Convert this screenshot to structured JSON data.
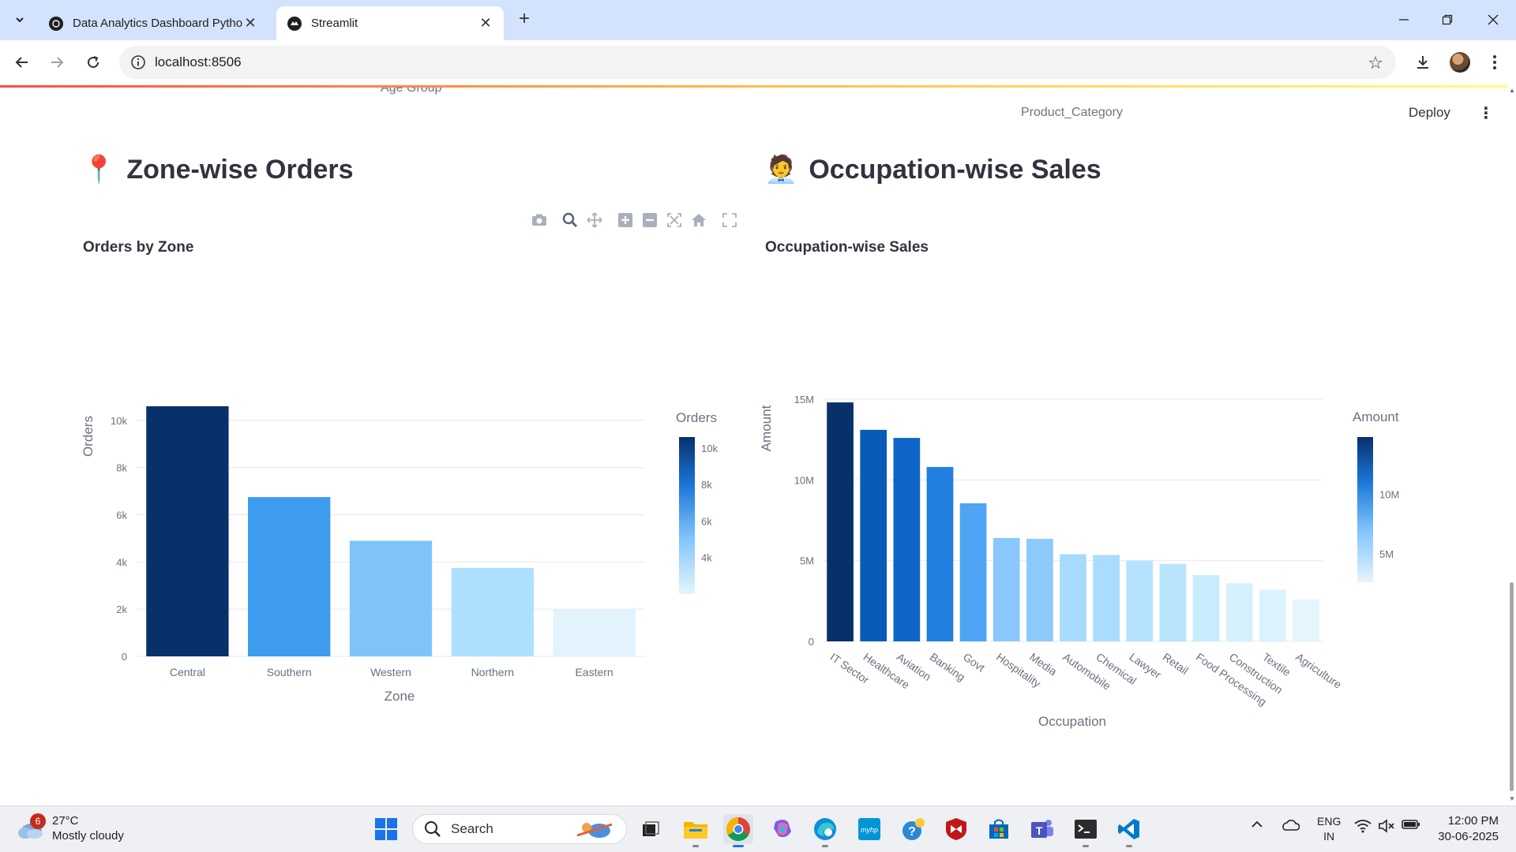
{
  "browser": {
    "tabs": [
      {
        "title": "Data Analytics Dashboard Pytho",
        "active": false
      },
      {
        "title": "Streamlit",
        "active": true
      }
    ],
    "url": "localhost:8506"
  },
  "app": {
    "cut_labels": {
      "age_group": "Age Group",
      "product_category": "Product_Category"
    },
    "deploy_label": "Deploy",
    "sections": {
      "zone": {
        "emoji": "📍",
        "title": "Zone-wise Orders"
      },
      "occupation": {
        "emoji": "🧑‍💼",
        "title": "Occupation-wise Sales"
      }
    }
  },
  "charts": {
    "zone": {
      "title": "Orders by Zone",
      "xlabel": "Zone",
      "ylabel": "Orders",
      "colorbar_title": "Orders",
      "y_ticks": [
        "0",
        "2k",
        "4k",
        "6k",
        "8k",
        "10k"
      ],
      "colorbar_ticks": [
        "10k",
        "8k",
        "6k",
        "4k"
      ]
    },
    "occupation": {
      "title": "Occupation-wise Sales",
      "xlabel": "Occupation",
      "ylabel": "Amount",
      "colorbar_title": "Amount",
      "y_ticks": [
        "0",
        "5M",
        "10M",
        "15M"
      ],
      "colorbar_ticks": [
        "10M",
        "5M"
      ]
    }
  },
  "chart_data": [
    {
      "type": "bar",
      "title": "Orders by Zone",
      "xlabel": "Zone",
      "ylabel": "Orders",
      "categories": [
        "Central",
        "Southern",
        "Western",
        "Northern",
        "Eastern"
      ],
      "values": [
        10600,
        6750,
        4900,
        3750,
        2000
      ],
      "ylim": [
        0,
        10800
      ],
      "colorscale": "Blues",
      "colors": [
        "#08306b",
        "#3d9bf0",
        "#7ec4fb",
        "#ade0fe",
        "#e3f3fe"
      ],
      "grid": true,
      "legend": "colorbar right"
    },
    {
      "type": "bar",
      "title": "Occupation-wise Sales",
      "xlabel": "Occupation",
      "ylabel": "Amount",
      "categories": [
        "IT Sector",
        "Healthcare",
        "Aviation",
        "Banking",
        "Govt",
        "Hospitality",
        "Media",
        "Automobile",
        "Chemical",
        "Lawyer",
        "Retail",
        "Food Processing",
        "Construction",
        "Textile",
        "Agriculture"
      ],
      "values": [
        14800000,
        13100000,
        12600000,
        10800000,
        8550000,
        6400000,
        6350000,
        5400000,
        5350000,
        5000000,
        4800000,
        4100000,
        3600000,
        3200000,
        2600000
      ],
      "ylim": [
        0,
        15000000
      ],
      "colorscale": "Blues",
      "colors": [
        "#08306b",
        "#0a5bb5",
        "#0e66c8",
        "#217fe0",
        "#4fa4f3",
        "#88c8fc",
        "#8ccafc",
        "#a7dbfe",
        "#a9dcfe",
        "#b5e2fe",
        "#b9e4fe",
        "#c9ebfe",
        "#d6f0fe",
        "#dcf2fe",
        "#e5f5fe"
      ],
      "grid": true,
      "legend": "colorbar right"
    }
  ],
  "taskbar": {
    "weather": {
      "badge": "6",
      "temp": "27°C",
      "desc": "Mostly cloudy"
    },
    "search_placeholder": "Search",
    "lang": {
      "line1": "ENG",
      "line2": "IN"
    },
    "time": "12:00 PM",
    "date": "30-06-2025"
  }
}
